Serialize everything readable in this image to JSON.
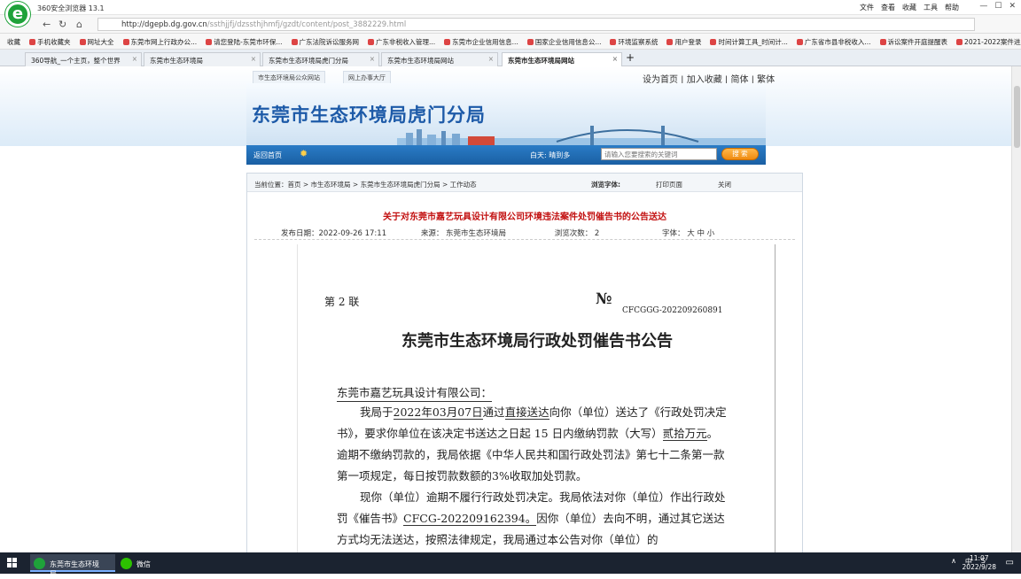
{
  "browser": {
    "app_title": "360安全浏览器 13.1",
    "menu": [
      "文件",
      "查看",
      "收藏",
      "工具",
      "帮助"
    ],
    "url_host": "http://dgepb.dg.gov.cn",
    "url_path": "/ssthjjfj/dzssthjhmfj/gzdt/content/post_3882229.html",
    "favorites": [
      "收藏",
      "手机收藏夹",
      "网址大全",
      "东莞市网上行政办公...",
      "请您登陆-东莞市环保...",
      "广东法院诉讼服务网",
      "广东非税收入管理...",
      "东莞市企业信用信息...",
      "国家企业信用信息公...",
      "环境监察系统",
      "用户登录",
      "时间计算工具_时间计...",
      "广东省市县非税收入...",
      "诉讼案件开庭提醒表",
      "2021-2022案件进度..."
    ],
    "tabs": [
      "360导航_一个主页，整个世界",
      "东莞市生态环境局",
      "东莞市生态环境局虎门分局",
      "东莞市生态环境局网站",
      "东莞市生态环境局网站"
    ]
  },
  "site": {
    "mini_links": [
      "市生态环境局公众网站",
      "网上办事大厅"
    ],
    "util_links": "设为首页 | 加入收藏 | 简体 | 繁体",
    "title": "东莞市生态环境局虎门分局",
    "nav_home": "返回首页",
    "weather": "白天: 晴到多",
    "search_placeholder": "请输入您要搜索的关键词",
    "search_button": "搜 索"
  },
  "article": {
    "crumb": "当前位置：首页 > 市生态环境局 > 东莞市生态环境局虎门分局 > 工作动态",
    "tools": [
      "浏览字体:",
      "打印页面",
      "关闭"
    ],
    "title": "关于对东莞市嘉艺玩具设计有限公司环境违法案件处罚催告书的公告送达",
    "publish": "发布日期：2022-09-26   17:11",
    "source": "来源：  东莞市生态环境局",
    "views": "浏览次数： 2",
    "fontsize": "字体：  大 中 小"
  },
  "document": {
    "copy_label": "第 2 联",
    "no_mark": "№",
    "notice_no": "CFCGGG-202209260891",
    "title": "东莞市生态环境局行政处罚催告书公告",
    "addressee": "东莞市嘉艺玩具设计有限公司：",
    "p1_a": "我局于",
    "p1_date": "2022年03月07日",
    "p1_b": "通过",
    "p1_method": "直接送达",
    "p1_c": "向你（单位）送达了《行政处罚决定书》，要求你单位在该决定书送达之日起 15 日内缴纳罚款（大写）",
    "p1_amount": "贰拾万元",
    "p1_d": "。逾期不缴纳罚款的，我局依据《中华人民共和国行政处罚法》第七十二条第一款第一项规定，每日按罚款数额的3%收取加处罚款。",
    "p2_a": "现你（单位）逾期不履行行政处罚决定。我局依法对你（单位）作出行政处罚《催告书》",
    "p2_no": "CFCG-202209162394。",
    "p2_b": "因你（单位）去向不明，通过其它送达方式均无法送达，按照法律规定，我局通过本公告对你（单位）的"
  },
  "taskbar": {
    "items": [
      "东莞市生态环境局...",
      "微信"
    ],
    "tray": [
      "∧",
      "中",
      "S"
    ],
    "time": "11:07",
    "date": "2022/9/28"
  }
}
